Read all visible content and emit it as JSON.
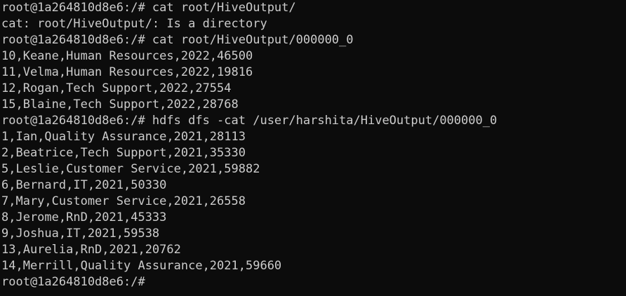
{
  "terminal": {
    "lines": [
      "root@1a264810d8e6:/# cat root/HiveOutput/",
      "cat: root/HiveOutput/: Is a directory",
      "root@1a264810d8e6:/# cat root/HiveOutput/000000_0",
      "10,Keane,Human Resources,2022,46500",
      "11,Velma,Human Resources,2022,19816",
      "12,Rogan,Tech Support,2022,27554",
      "15,Blaine,Tech Support,2022,28768",
      "root@1a264810d8e6:/# hdfs dfs -cat /user/harshita/HiveOutput/000000_0",
      "1,Ian,Quality Assurance,2021,28113",
      "2,Beatrice,Tech Support,2021,35330",
      "5,Leslie,Customer Service,2021,59882",
      "6,Bernard,IT,2021,50330",
      "7,Mary,Customer Service,2021,26558",
      "8,Jerome,RnD,2021,45333",
      "9,Joshua,IT,2021,59538",
      "13,Aurelia,RnD,2021,20762",
      "14,Merrill,Quality Assurance,2021,59660",
      "root@1a264810d8e6:/#"
    ]
  },
  "colors": {
    "background": "#0c0c0c",
    "foreground": "#cccccc"
  }
}
